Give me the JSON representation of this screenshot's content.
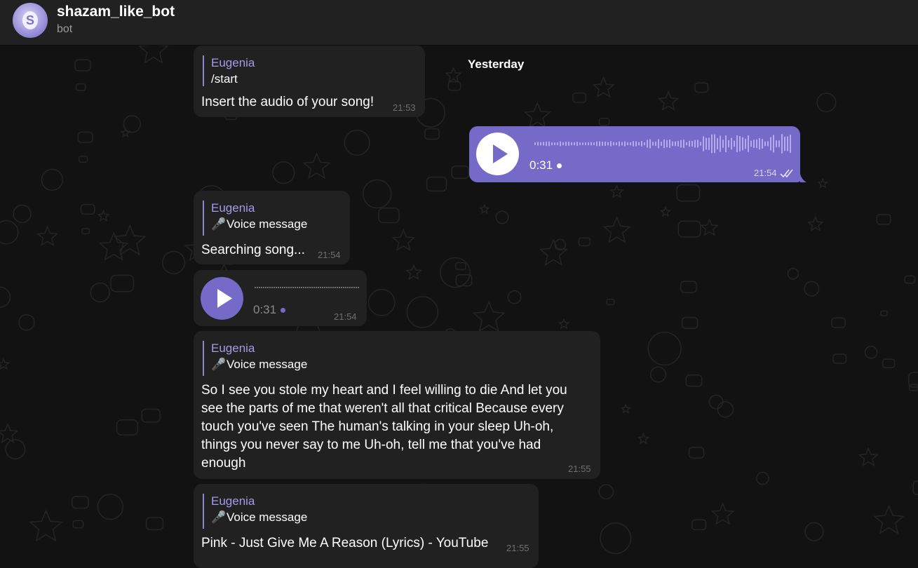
{
  "header": {
    "title": "shazam_like_bot",
    "subtitle": "bot",
    "avatar_letter": "S"
  },
  "date_separator": "Yesterday",
  "messages": [
    {
      "type": "text",
      "reply_name": "Eugenia",
      "reply_text": "/start",
      "text": "Insert the audio of your song!",
      "time": "21:53"
    },
    {
      "type": "voice_outgoing",
      "duration": "0:31",
      "time": "21:54",
      "status": "read-double-check"
    },
    {
      "type": "text",
      "reply_name": "Eugenia",
      "reply_text": "Voice message",
      "reply_icon": "microphone-icon",
      "text": "Searching song...",
      "time": "21:54"
    },
    {
      "type": "voice_incoming",
      "duration": "0:31",
      "time": "21:54"
    },
    {
      "type": "text",
      "reply_name": "Eugenia",
      "reply_text": "Voice message",
      "reply_icon": "microphone-icon",
      "lines": [
        "So I see you stole my heart and I feel willing to die And let you",
        "see the parts of me that weren't all that critical Because every",
        "touch you've seen The human's talking in your sleep Uh-oh,",
        "things you never say to me Uh-oh, tell me that you've had",
        "enough"
      ],
      "time": "21:55"
    },
    {
      "type": "text",
      "reply_name": "Eugenia",
      "reply_text": "Voice message",
      "reply_icon": "microphone-icon",
      "text": "Pink - Just Give Me A Reason (Lyrics) - YouTube",
      "time": "21:55"
    }
  ],
  "colors": {
    "background": "#121212",
    "bubble_incoming": "#212121",
    "bubble_outgoing": "#766ac8",
    "accent": "#a49be6"
  }
}
